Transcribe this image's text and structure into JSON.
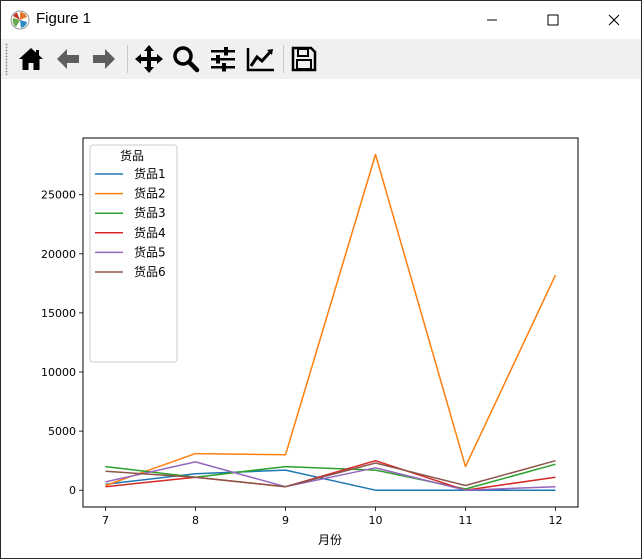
{
  "window": {
    "title": "Figure 1",
    "controls": {
      "minimize": "minimize",
      "maximize": "maximize",
      "close": "close"
    }
  },
  "toolbar": {
    "items": [
      {
        "name": "home",
        "icon": "home-icon"
      },
      {
        "name": "back",
        "icon": "arrow-left-icon"
      },
      {
        "name": "forward",
        "icon": "arrow-right-icon"
      },
      {
        "name": "pan",
        "icon": "move-icon"
      },
      {
        "name": "zoom",
        "icon": "magnifier-icon"
      },
      {
        "name": "configure-subplots",
        "icon": "sliders-icon"
      },
      {
        "name": "edit-axis",
        "icon": "line-chart-icon"
      },
      {
        "name": "save",
        "icon": "floppy-disk-icon"
      }
    ]
  },
  "chart_data": {
    "type": "line",
    "title": "",
    "xlabel": "月份",
    "ylabel": "",
    "x": [
      7,
      8,
      9,
      10,
      11,
      12
    ],
    "xlim": [
      6.75,
      12.25
    ],
    "ylim": [
      -1420,
      29800
    ],
    "yticks": [
      0,
      5000,
      10000,
      15000,
      20000,
      25000
    ],
    "grid": false,
    "legend": {
      "title": "货品",
      "position": "top-left"
    },
    "series": [
      {
        "name": "货品1",
        "color": "#1f77b4",
        "values": [
          500,
          1400,
          1700,
          0,
          0,
          0
        ]
      },
      {
        "name": "货品2",
        "color": "#ff7f0e",
        "values": [
          400,
          3100,
          3000,
          28400,
          2000,
          18200
        ]
      },
      {
        "name": "货品3",
        "color": "#2ca02c",
        "values": [
          2000,
          1100,
          2000,
          1700,
          100,
          2200
        ]
      },
      {
        "name": "货品4",
        "color": "#d62728",
        "values": [
          300,
          1100,
          300,
          2500,
          0,
          1100
        ]
      },
      {
        "name": "货品5",
        "color": "#9467bd",
        "values": [
          700,
          2400,
          300,
          1900,
          0,
          300
        ]
      },
      {
        "name": "货品6",
        "color": "#8c564b",
        "values": [
          1600,
          1100,
          300,
          2300,
          400,
          2500
        ]
      }
    ]
  }
}
